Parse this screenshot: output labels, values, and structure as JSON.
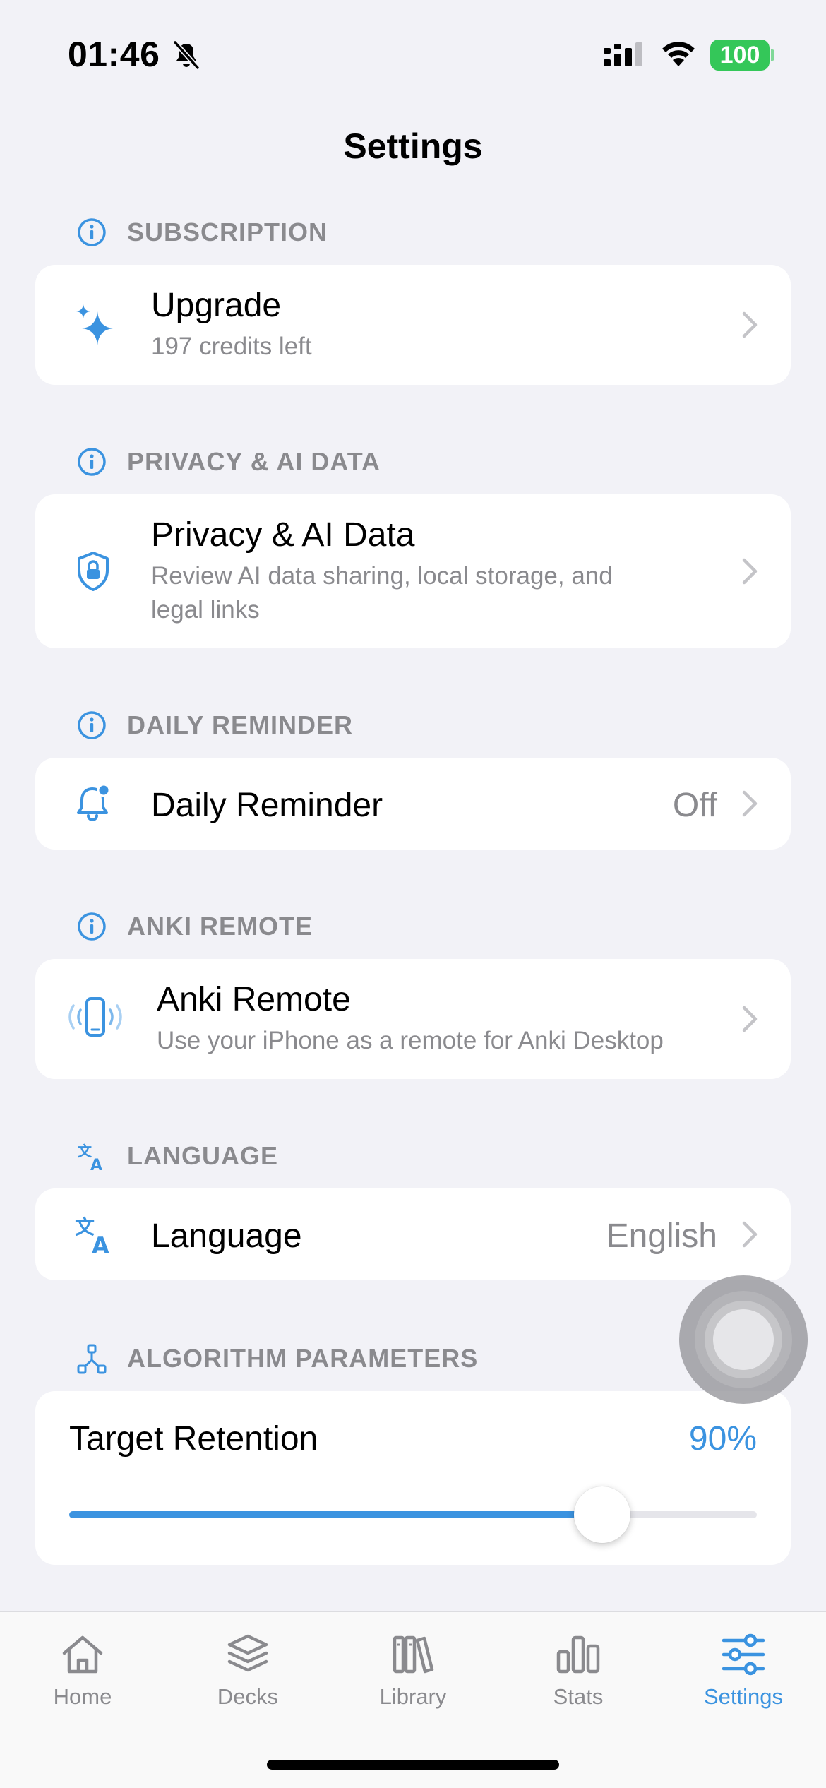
{
  "status": {
    "time": "01:46",
    "battery": "100"
  },
  "title": "Settings",
  "colors": {
    "accent": "#3B93E0",
    "background": "#F2F2F7",
    "secondary_text": "#8A8A8E"
  },
  "sections": {
    "subscription": {
      "header": "SUBSCRIPTION",
      "header_icon": "info-icon",
      "row": {
        "icon": "sparkles-icon",
        "title": "Upgrade",
        "subtitle": "197 credits left"
      }
    },
    "privacy": {
      "header": "PRIVACY & AI DATA",
      "header_icon": "info-icon",
      "row": {
        "icon": "lock-shield-icon",
        "title": "Privacy & AI Data",
        "subtitle_line1": "Review AI data sharing, local storage, and",
        "subtitle_line2": "legal links"
      }
    },
    "reminder": {
      "header": "DAILY REMINDER",
      "header_icon": "info-icon",
      "row": {
        "icon": "bell-badge-icon",
        "title": "Daily Reminder",
        "value": "Off"
      }
    },
    "anki_remote": {
      "header": "ANKI REMOTE",
      "header_icon": "info-icon",
      "row": {
        "icon": "phone-waves-icon",
        "title": "Anki Remote",
        "subtitle": "Use your iPhone as a remote for Anki Desktop"
      }
    },
    "language": {
      "header": "LANGUAGE",
      "header_icon": "translate-icon",
      "row": {
        "icon": "translate-icon",
        "title": "Language",
        "value": "English"
      }
    },
    "algorithm": {
      "header": "ALGORITHM PARAMETERS",
      "header_icon": "network-icon",
      "row": {
        "title": "Target Retention",
        "value": "90%",
        "slider_fraction": 0.775
      }
    }
  },
  "tabs": [
    {
      "label": "Home",
      "icon": "house-icon",
      "active": false
    },
    {
      "label": "Decks",
      "icon": "stack-icon",
      "active": false
    },
    {
      "label": "Library",
      "icon": "books-icon",
      "active": false
    },
    {
      "label": "Stats",
      "icon": "chart-bar-icon",
      "active": false
    },
    {
      "label": "Settings",
      "icon": "sliders-icon",
      "active": true
    }
  ]
}
